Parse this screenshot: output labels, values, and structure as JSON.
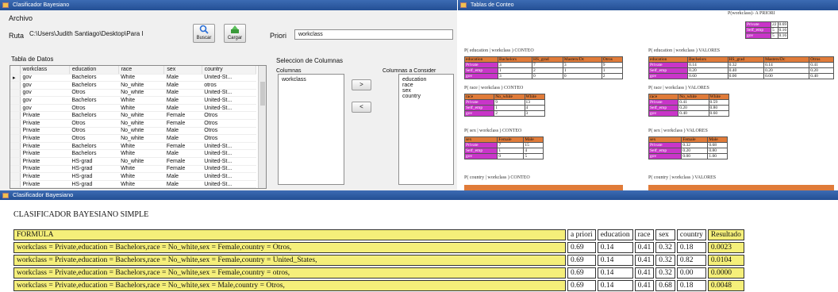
{
  "win1": {
    "title": "Clasificador Bayesiano",
    "archivo": "Archivo",
    "ruta_label": "Ruta",
    "ruta_value": "C:\\Users\\Judith Santiago\\Desktop\\Para I",
    "buscar": "Buscar",
    "cargar": "Cargar",
    "priori_label": "Priori",
    "priori_value": "workclass",
    "tabla_label": "Tabla de Datos",
    "seleccion_label": "Seleccion de Columnas",
    "columnas_label": "Columnas",
    "considerar_label": "Columnas a Consider",
    "columnas_items": [
      "workclass"
    ],
    "considerar_items": [
      "education",
      "race",
      "sex",
      "country"
    ],
    "move_right": ">",
    "move_left": "<",
    "grid_headers": [
      "workclass",
      "education",
      "race",
      "sex",
      "country"
    ],
    "grid_rows": [
      [
        "gov",
        "Bachelors",
        "White",
        "Male",
        "United-St..."
      ],
      [
        "gov",
        "Bachelors",
        "No_white",
        "Male",
        "otros"
      ],
      [
        "gov",
        "Otros",
        "No_white",
        "Male",
        "United-St..."
      ],
      [
        "gov",
        "Bachelors",
        "White",
        "Male",
        "United-St..."
      ],
      [
        "gov",
        "Otros",
        "White",
        "Male",
        "United-St..."
      ],
      [
        "Private",
        "Bachelors",
        "No_white",
        "Female",
        "Otros"
      ],
      [
        "Private",
        "Otros",
        "No_white",
        "Female",
        "Otros"
      ],
      [
        "Private",
        "Otros",
        "No_white",
        "Male",
        "Otros"
      ],
      [
        "Private",
        "Otros",
        "No_white",
        "Male",
        "Otros"
      ],
      [
        "Private",
        "Bachelors",
        "White",
        "Female",
        "United-St..."
      ],
      [
        "Private",
        "Bachelors",
        "White",
        "Male",
        "United-St..."
      ],
      [
        "Private",
        "HS-grad",
        "No_white",
        "Female",
        "United-St..."
      ],
      [
        "Private",
        "HS-grad",
        "White",
        "Female",
        "United-St..."
      ],
      [
        "Private",
        "HS-grad",
        "White",
        "Male",
        "United-St..."
      ],
      [
        "Private",
        "HS-grad",
        "White",
        "Male",
        "United-St..."
      ]
    ]
  },
  "win2": {
    "title": "Tablas de Conteo",
    "priori_title": "P(workclass)- A PRIORI",
    "priori_rows": [
      [
        "Private",
        "22",
        "0.69"
      ],
      [
        "Self_emp",
        "5",
        "0.16"
      ],
      [
        "gov",
        "5",
        "0.16"
      ]
    ],
    "edu_conteo": {
      "title": "P( education | workclass ) CONTEO",
      "headers": [
        "education",
        "Bachelors",
        "HS_grad",
        "Masters/Dc",
        "Otros"
      ],
      "rows": [
        [
          "Private",
          "3",
          "7",
          "3",
          "9"
        ],
        [
          "Self_emp",
          "1",
          "2",
          "1",
          "1"
        ],
        [
          "gov",
          "3",
          "0",
          "0",
          "2"
        ]
      ]
    },
    "edu_valores": {
      "title": "P( education | workclass ) VALORES",
      "headers": [
        "education",
        "Bachelors",
        "HS_grad",
        "Masters/Dc",
        "Otros"
      ],
      "rows": [
        [
          "Private",
          "0.14",
          "0.32",
          "0.14",
          "0.41"
        ],
        [
          "Self_emp",
          "0.20",
          "0.40",
          "0.20",
          "0.20"
        ],
        [
          "gov",
          "0.60",
          "0.00",
          "0.00",
          "0.40"
        ]
      ]
    },
    "race_conteo": {
      "title": "P( race | workclass ) CONTEO",
      "headers": [
        "race",
        "No_white",
        "White"
      ],
      "rows": [
        [
          "Private",
          "9",
          "13"
        ],
        [
          "Self_emp",
          "1",
          "4"
        ],
        [
          "gov",
          "2",
          "3"
        ]
      ]
    },
    "race_valores": {
      "title": "P( race | workclass ) VALORES",
      "headers": [
        "race",
        "No_white",
        "White"
      ],
      "rows": [
        [
          "Private",
          "0.41",
          "0.59"
        ],
        [
          "Self_emp",
          "0.20",
          "0.80"
        ],
        [
          "gov",
          "0.40",
          "0.60"
        ]
      ]
    },
    "sex_conteo": {
      "title": "P( sex | workclass ) CONTEO",
      "headers": [
        "sex",
        "Female",
        "Male"
      ],
      "rows": [
        [
          "Private",
          "7",
          "15"
        ],
        [
          "Self_emp",
          "1",
          "4"
        ],
        [
          "gov",
          "0",
          "5"
        ]
      ]
    },
    "sex_valores": {
      "title": "P( sex | workclass ) VALORES",
      "headers": [
        "sex",
        "Female",
        "Male"
      ],
      "rows": [
        [
          "Private",
          "0.32",
          "0.68"
        ],
        [
          "Self_emp",
          "0.20",
          "0.80"
        ],
        [
          "gov",
          "0.00",
          "1.00"
        ]
      ]
    },
    "country_conteo_title": "P( country | workclass ) CONTEO",
    "country_valores_title": "P( country | workclass ) VALORES"
  },
  "win3": {
    "title": "Clasificador Bayesiano",
    "heading": "CLASIFICADOR BAYESIANO SIMPLE",
    "headers": [
      "FORMULA",
      "a priori",
      "education",
      "race",
      "sex",
      "country",
      "Resultado"
    ],
    "rows": [
      [
        "workclass = Private,education = Bachelors,race = No_white,sex = Female,country = Otros,",
        "0.69",
        "0.14",
        "0.41",
        "0.32",
        "0.18",
        "0.0023"
      ],
      [
        "workclass = Private,education = Bachelors,race = No_white,sex = Female,country = United_States,",
        "0.69",
        "0.14",
        "0.41",
        "0.32",
        "0.82",
        "0.0104"
      ],
      [
        "workclass = Private,education = Bachelors,race = No_white,sex = Female,country = otros,",
        "0.69",
        "0.14",
        "0.41",
        "0.32",
        "0.00",
        "0.0000"
      ],
      [
        "workclass = Private,education = Bachelors,race = No_white,sex = Male,country = Otros,",
        "0.69",
        "0.14",
        "0.41",
        "0.68",
        "0.18",
        "0.0048"
      ]
    ]
  }
}
